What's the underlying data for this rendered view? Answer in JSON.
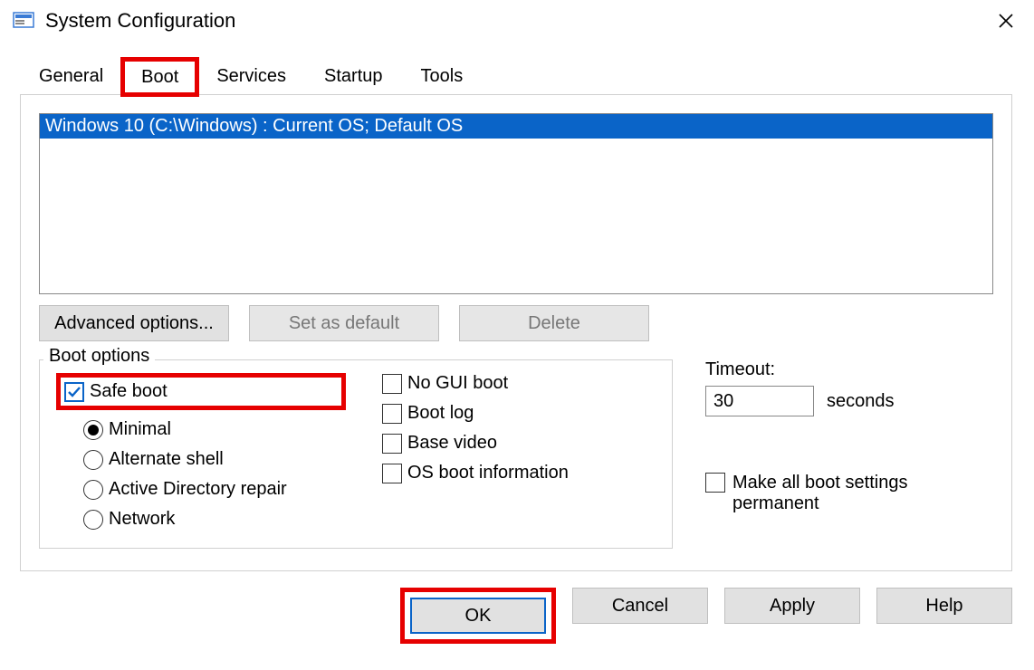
{
  "window": {
    "title": "System Configuration"
  },
  "tabs": {
    "general": "General",
    "boot": "Boot",
    "services": "Services",
    "startup": "Startup",
    "tools": "Tools",
    "active": "boot"
  },
  "boot_list": {
    "items": [
      "Windows 10 (C:\\Windows) : Current OS; Default OS"
    ]
  },
  "buttons": {
    "advanced": "Advanced options...",
    "set_default": "Set as default",
    "delete": "Delete",
    "ok": "OK",
    "cancel": "Cancel",
    "apply": "Apply",
    "help": "Help"
  },
  "boot_options": {
    "legend": "Boot options",
    "safe_boot": {
      "label": "Safe boot",
      "checked": true
    },
    "radios": {
      "selected": "minimal",
      "minimal": "Minimal",
      "altshell": "Alternate shell",
      "adrepair": "Active Directory repair",
      "network": "Network"
    },
    "no_gui": {
      "label": "No GUI boot",
      "checked": false
    },
    "boot_log": {
      "label": "Boot log",
      "checked": false
    },
    "base_video": {
      "label": "Base video",
      "checked": false
    },
    "os_boot_info": {
      "label": "OS boot information",
      "checked": false
    }
  },
  "timeout": {
    "label": "Timeout:",
    "value": "30",
    "unit": "seconds"
  },
  "permanent": {
    "label_line1": "Make all boot settings",
    "label_line2": "permanent",
    "checked": false
  },
  "highlights": [
    "tab-boot",
    "safe-boot-checkbox",
    "ok-button"
  ]
}
